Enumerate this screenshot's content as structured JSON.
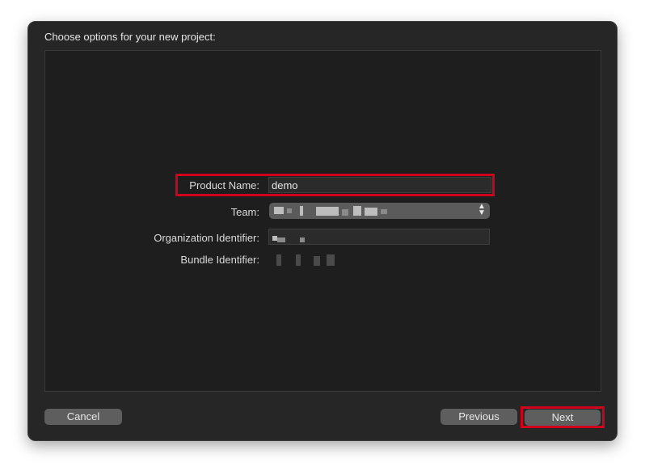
{
  "dialog": {
    "title": "Choose options for your new project:"
  },
  "form": {
    "product_name_label": "Product Name:",
    "product_name_value": "demo",
    "team_label": "Team:",
    "org_identifier_label": "Organization Identifier:",
    "bundle_identifier_label": "Bundle Identifier:"
  },
  "buttons": {
    "cancel": "Cancel",
    "previous": "Previous",
    "next": "Next"
  },
  "colors": {
    "highlight": "#d0021b",
    "dialog_bg": "#262626",
    "button_bg": "#5e5e5e"
  },
  "icons": {
    "team_popup_indicator": "chevron-up-down-icon"
  }
}
